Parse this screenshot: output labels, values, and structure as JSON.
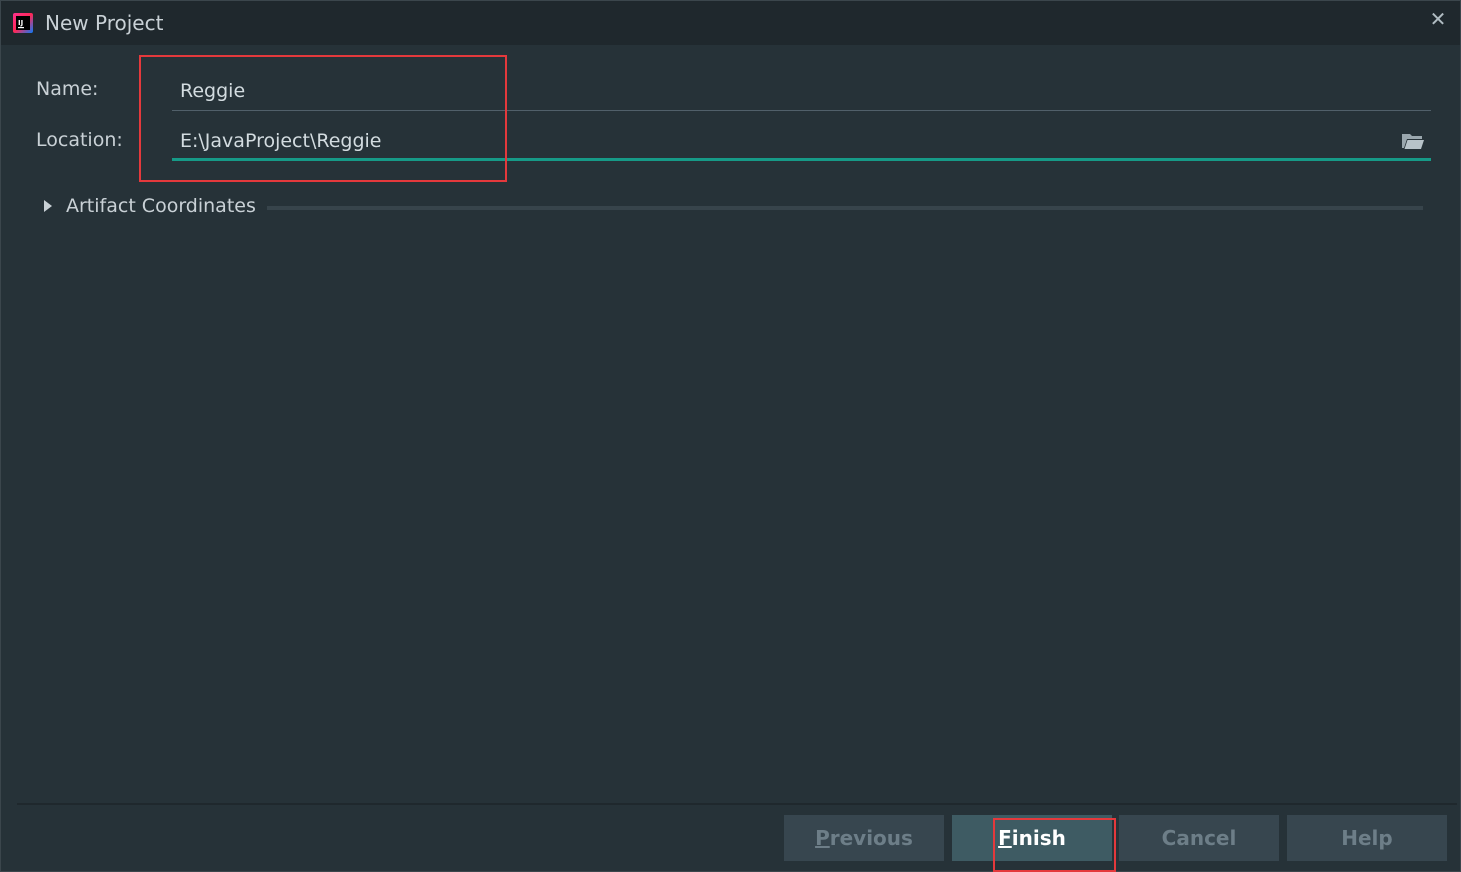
{
  "window": {
    "title": "New Project",
    "close_symbol": "✕"
  },
  "form": {
    "name_label": "Name:",
    "name_value": "Reggie",
    "location_label": "Location:",
    "location_value": "E:\\JavaProject\\Reggie"
  },
  "artifact": {
    "label": "Artifact Coordinates",
    "expanded": false
  },
  "buttons": {
    "previous": {
      "mnemonic": "P",
      "rest": "revious",
      "enabled": false
    },
    "finish": {
      "mnemonic": "F",
      "rest": "inish",
      "enabled": true
    },
    "cancel": {
      "label": "Cancel"
    },
    "help": {
      "label": "Help"
    }
  },
  "icons": [
    "intellij-app-icon",
    "close-icon",
    "folder-icon",
    "triangle-right-icon"
  ],
  "colors": {
    "background": "#263238",
    "titlebar": "#1f282d",
    "focus_underline": "#169a87",
    "highlight_box": "#e4393c",
    "primary_button": "#3e5b63"
  }
}
